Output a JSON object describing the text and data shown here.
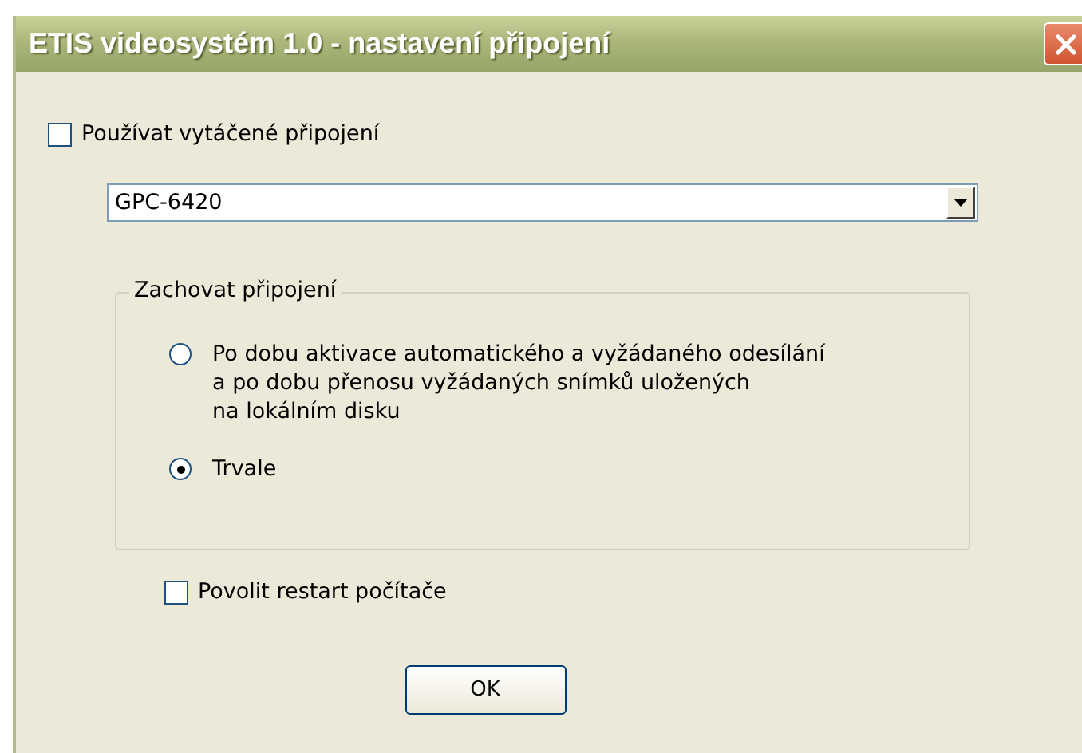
{
  "window": {
    "title": "ETIS videosystém 1.0 - nastavení připojení"
  },
  "dialup_checkbox": {
    "label": "Používat vytáčené připojení",
    "checked": false
  },
  "connection_dropdown": {
    "value": "GPC-6420"
  },
  "keep_connection": {
    "legend": "Zachovat připojení",
    "options": [
      {
        "label": "Po dobu aktivace automatického a vyžádaného odesílání\na po dobu přenosu vyžádaných snímků uložených\nna lokálním disku",
        "selected": false
      },
      {
        "label": "Trvale",
        "selected": true
      }
    ]
  },
  "restart_checkbox": {
    "label": "Povolit restart počítače",
    "checked": false
  },
  "buttons": [
    {
      "label": "OK"
    }
  ]
}
